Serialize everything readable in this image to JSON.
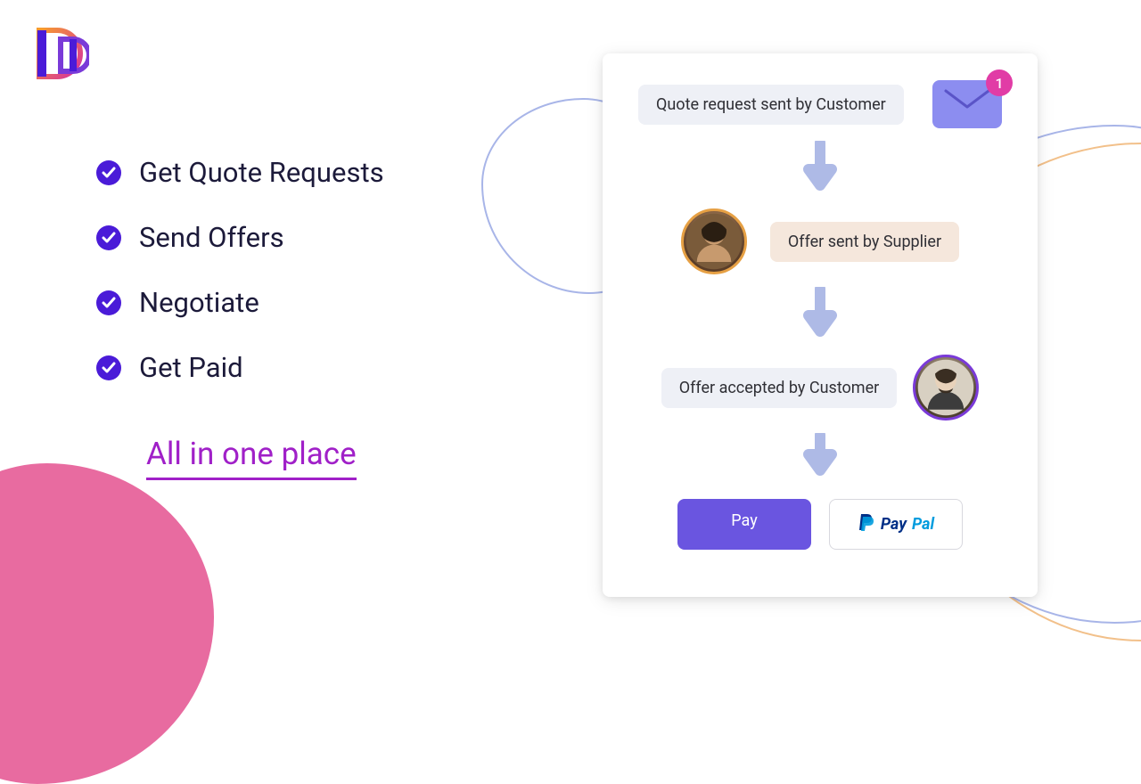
{
  "features": {
    "items": [
      {
        "label": "Get Quote Requests"
      },
      {
        "label": "Send Offers"
      },
      {
        "label": "Negotiate"
      },
      {
        "label": "Get Paid"
      }
    ],
    "tagline": "All in one place"
  },
  "card": {
    "step1": "Quote request sent by Customer",
    "step2": "Offer sent by Supplier",
    "step3": "Offer accepted by Customer",
    "notification_count": "1",
    "pay_button": "Pay",
    "paypal_pay": "Pay",
    "paypal_pal": "Pal"
  }
}
